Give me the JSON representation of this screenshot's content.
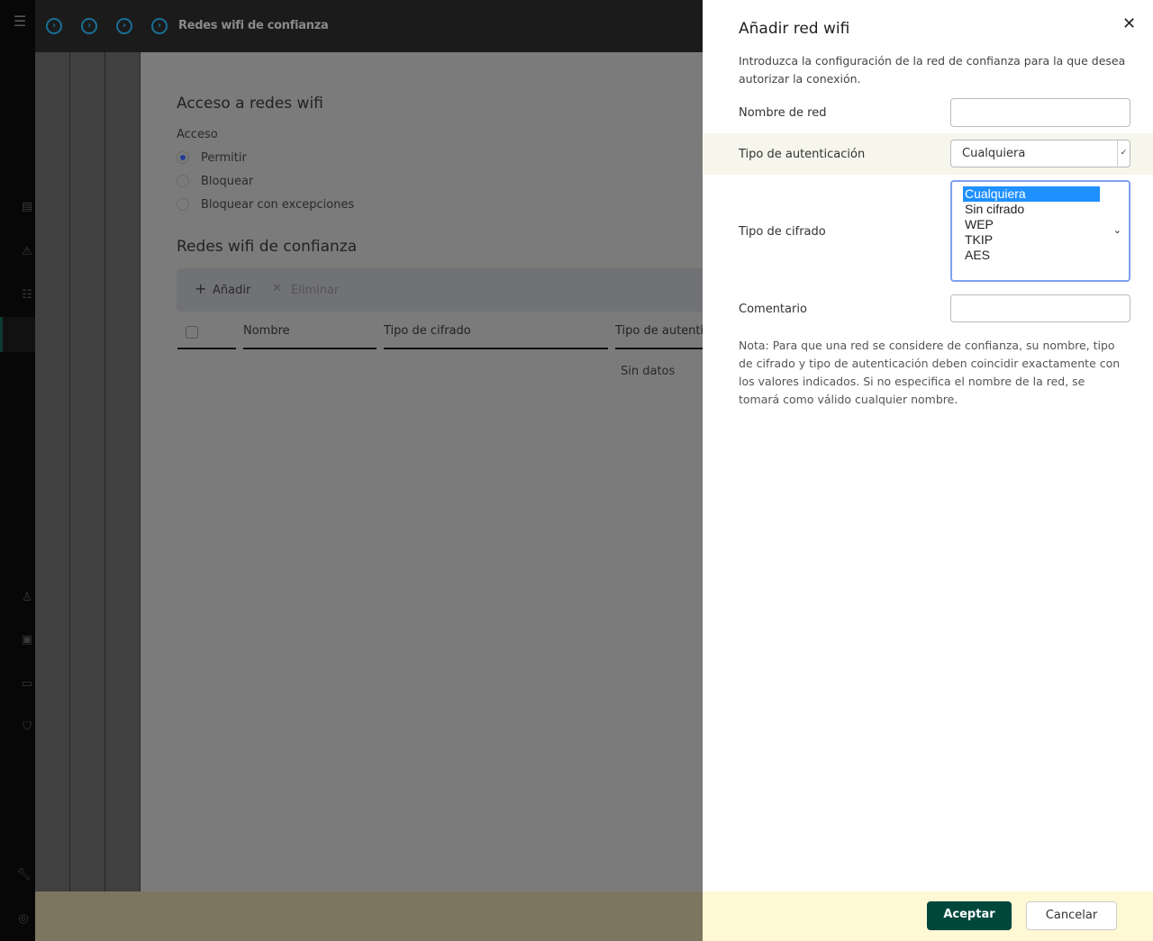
{
  "header": {
    "title": "Redes wifi de confianza"
  },
  "main": {
    "section_title": "Acceso a redes wifi",
    "access_label": "Acceso",
    "access_options": [
      {
        "label": "Permitir",
        "selected": true
      },
      {
        "label": "Bloquear",
        "selected": false
      },
      {
        "label": "Bloquear con excepciones",
        "selected": false
      }
    ],
    "trusted_title": "Redes wifi de confianza",
    "add_label": "Añadir",
    "delete_label": "Eliminar",
    "columns": [
      "Nombre",
      "Tipo de cifrado",
      "Tipo de autenti"
    ],
    "empty_text": "Sin datos"
  },
  "panel": {
    "title": "Añadir red wifi",
    "description": "Introduzca la configuración de la red de confianza para la que desea autorizar la conexión.",
    "network_name_label": "Nombre de red",
    "network_name_value": "",
    "auth_label": "Tipo de autenticación",
    "auth_value": "Cualquiera",
    "cipher_label": "Tipo de cifrado",
    "cipher_options": [
      "Cualquiera",
      "Sin cifrado",
      "WEP",
      "TKIP",
      "AES"
    ],
    "cipher_selected": "Cualquiera",
    "comment_label": "Comentario",
    "comment_value": "",
    "note": "Nota: Para que una red se considere de confianza, su nombre, tipo de cifrado y tipo de autenticación deben coincidir exactamente con los valores indicados. Si no especifica el nombre de la red, se tomará como válido cualquier nombre.",
    "accept_label": "Aceptar",
    "cancel_label": "Cancelar"
  },
  "colors": {
    "accent": "#00473c",
    "footer": "#fff8d4",
    "selection": "#1e90ff"
  }
}
